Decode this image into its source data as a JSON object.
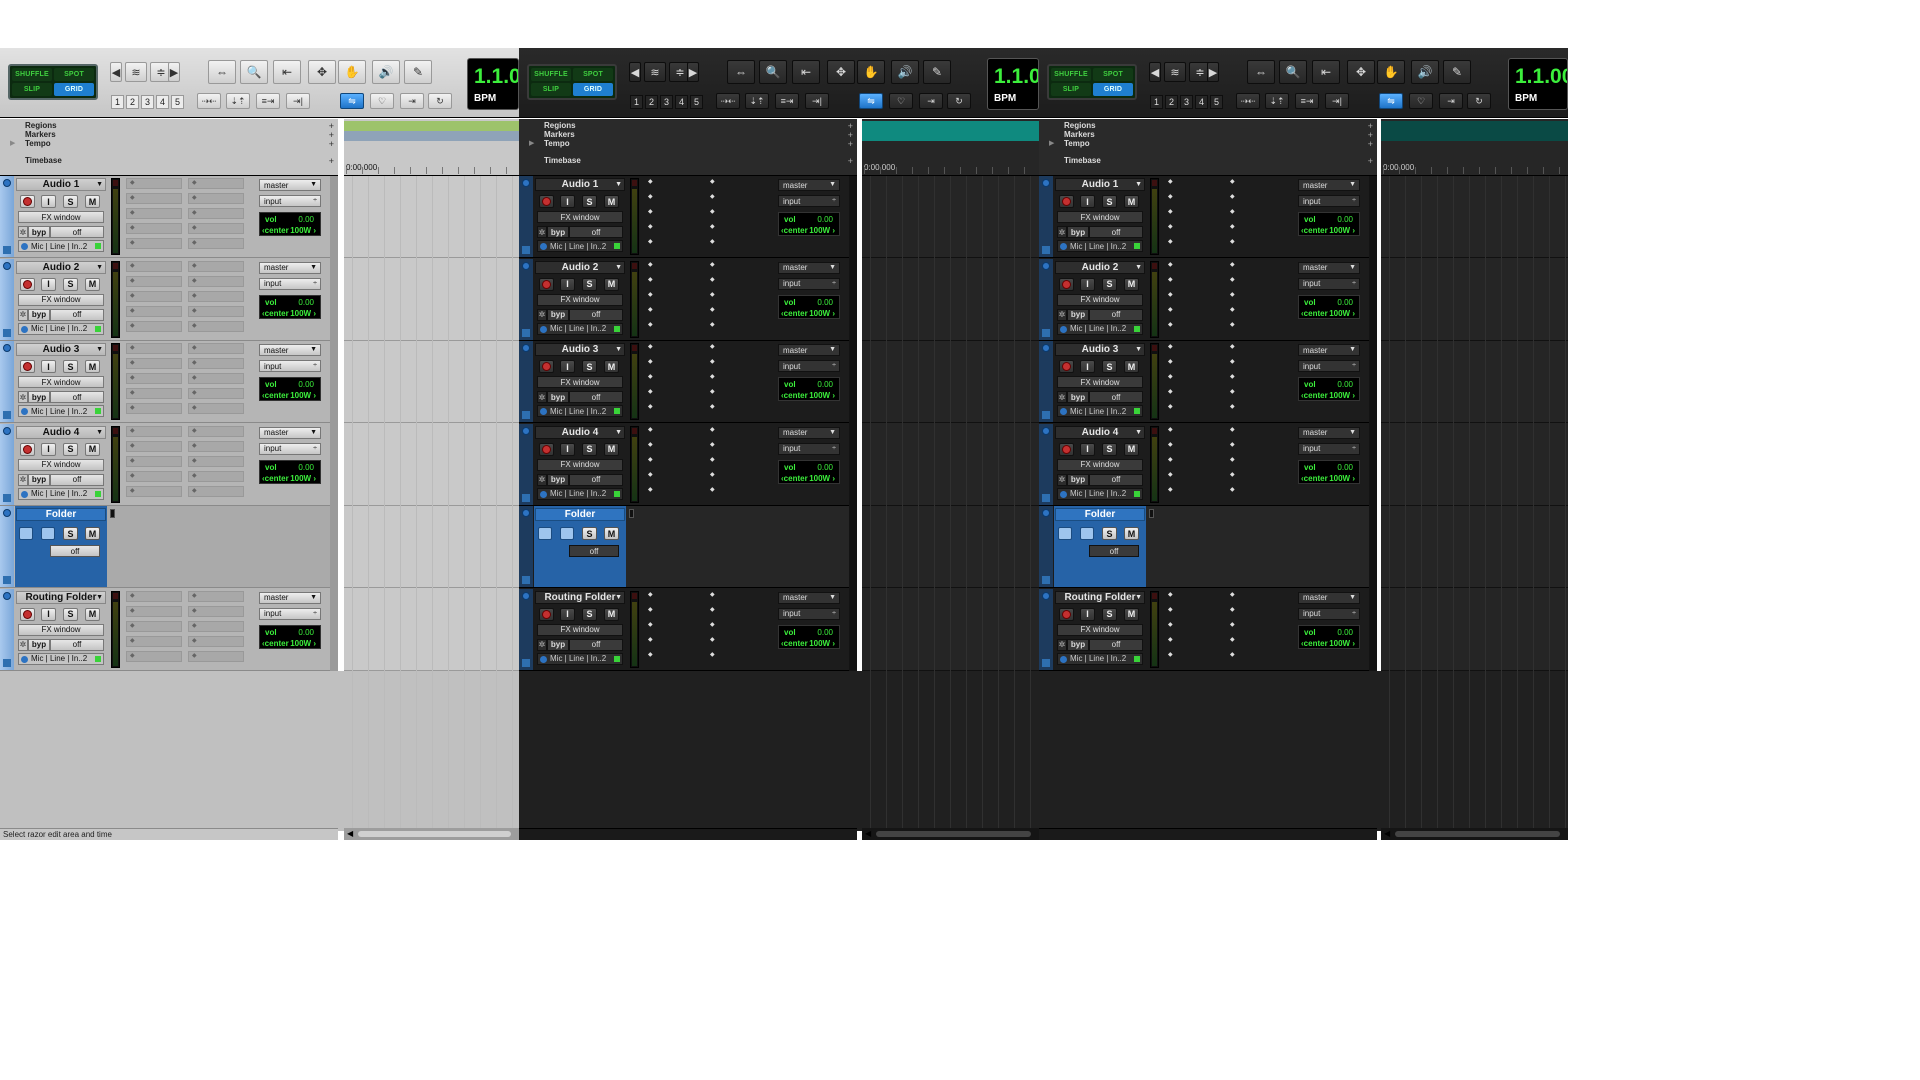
{
  "mode_buttons": {
    "shuffle": "SHUFFLE",
    "spot": "SPOT",
    "slip": "SLIP",
    "grid": "GRID"
  },
  "toolbar": {
    "tool_icons": [
      "zoom-in-out-icon",
      "trim-icon",
      "select-icon",
      "grabber-icon",
      "scrub-icon",
      "pencil-icon",
      "magnifier-icon",
      "hand-icon",
      "speaker-icon"
    ],
    "zoom_presets": [
      "1",
      "2",
      "3",
      "4",
      "5"
    ],
    "counter_value": "1.1.00",
    "bpm_label": "BPM"
  },
  "rulers": {
    "regions": "Regions",
    "markers": "Markers",
    "tempo": "Tempo",
    "timebase": "Timebase",
    "start_time": "0:00.000"
  },
  "tracks": [
    {
      "name": "Audio 1",
      "fx": "FX window",
      "bypass": "byp",
      "off": "off",
      "io": "Mic | Line | In..2",
      "out": "master",
      "in": "input",
      "vol_label": "vol",
      "vol": "0.00",
      "pan_label": "‹center",
      "pan": "100W ›"
    },
    {
      "name": "Audio 2",
      "fx": "FX window",
      "bypass": "byp",
      "off": "off",
      "io": "Mic | Line | In..2",
      "out": "master",
      "in": "input",
      "vol_label": "vol",
      "vol": "0.00",
      "pan_label": "‹center",
      "pan": "100W ›"
    },
    {
      "name": "Audio 3",
      "fx": "FX window",
      "bypass": "byp",
      "off": "off",
      "io": "Mic | Line | In..2",
      "out": "master",
      "in": "input",
      "vol_label": "vol",
      "vol": "0.00",
      "pan_label": "‹center",
      "pan": "100W ›"
    },
    {
      "name": "Audio 4",
      "fx": "FX window",
      "bypass": "byp",
      "off": "off",
      "io": "Mic | Line | In..2",
      "out": "master",
      "in": "input",
      "vol_label": "vol",
      "vol": "0.00",
      "pan_label": "‹center",
      "pan": "100W ›"
    }
  ],
  "folder": {
    "name": "Folder",
    "solo": "S",
    "mute": "M",
    "off": "off"
  },
  "routing_folder": {
    "name": "Routing Folder",
    "fx": "FX window",
    "bypass": "byp",
    "off": "off",
    "io": "Mic | Line | In..2",
    "out": "master",
    "in": "input",
    "vol_label": "vol",
    "vol": "0.00",
    "pan_label": "‹center",
    "pan": "100W ›"
  },
  "track_buttons": {
    "input": "I",
    "solo": "S",
    "mute": "M"
  },
  "status_bar": "Select razor edit area and time",
  "themes": {
    "classic_light": {
      "region_strip": "#9dc36b",
      "tempo_strip": "#8fa3b8"
    },
    "dark_teal": {
      "region_strip": "#0f8a7f",
      "tempo_strip": "#0f8a7f"
    },
    "darker": {
      "region_strip": "#0a4a45",
      "tempo_strip": "#0a4a45"
    }
  }
}
